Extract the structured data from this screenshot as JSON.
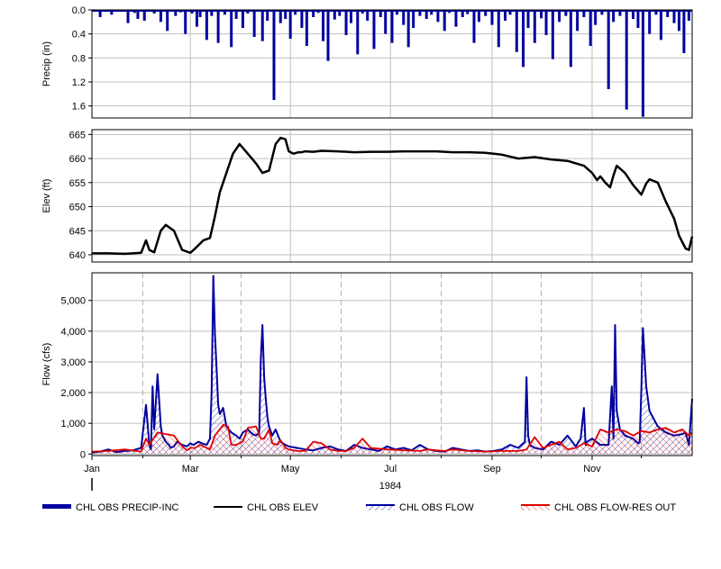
{
  "chart_data": [
    {
      "type": "bar",
      "ylabel": "Precip (in)",
      "yticks": [
        "0.0",
        "0.4",
        "0.8",
        "1.2",
        "1.6"
      ],
      "ylim": [
        0,
        1.8
      ],
      "y_inverted": true,
      "grid": true,
      "series": [
        {
          "legend_key": "CHL OBS PRECIP-INC",
          "color": "#0000a0",
          "x_day": [
            5,
            12,
            22,
            26,
            28,
            32,
            38,
            42,
            46,
            51,
            54,
            57,
            61,
            64,
            66,
            70,
            73,
            77,
            81,
            85,
            88,
            92,
            95,
            99,
            104,
            107,
            111,
            115,
            118,
            121,
            124,
            128,
            131,
            135,
            138,
            141,
            144,
            148,
            151,
            155,
            158,
            162,
            165,
            168,
            172,
            176,
            179,
            183,
            186,
            190,
            193,
            196,
            200,
            204,
            207,
            211,
            215,
            218,
            222,
            226,
            229,
            233,
            236,
            240,
            244,
            248,
            252,
            255,
            259,
            263,
            266,
            270,
            274,
            277,
            281,
            285,
            289,
            292,
            296,
            300,
            304,
            307,
            311,
            315,
            318,
            322,
            326,
            330,
            333,
            336,
            340,
            344,
            347,
            351,
            355,
            358,
            361,
            364
          ],
          "values": [
            0.12,
            0.08,
            0.22,
            0.05,
            0.15,
            0.18,
            0.06,
            0.2,
            0.35,
            0.1,
            0.04,
            0.4,
            0.06,
            0.28,
            0.12,
            0.5,
            0.1,
            0.55,
            0.08,
            0.62,
            0.15,
            0.3,
            0.06,
            0.45,
            0.52,
            0.18,
            1.5,
            0.22,
            0.15,
            0.48,
            0.08,
            0.3,
            0.6,
            0.12,
            0.05,
            0.52,
            0.85,
            0.16,
            0.1,
            0.42,
            0.22,
            0.74,
            0.06,
            0.18,
            0.65,
            0.12,
            0.4,
            0.55,
            0.08,
            0.25,
            0.62,
            0.3,
            0.1,
            0.15,
            0.08,
            0.2,
            0.35,
            0.05,
            0.28,
            0.12,
            0.07,
            0.55,
            0.2,
            0.1,
            0.25,
            0.62,
            0.18,
            0.08,
            0.7,
            0.95,
            0.3,
            0.55,
            0.14,
            0.42,
            0.82,
            0.2,
            0.1,
            0.95,
            0.35,
            0.12,
            0.6,
            0.25,
            0.08,
            1.32,
            0.2,
            0.1,
            1.66,
            0.15,
            0.3,
            1.78,
            0.4,
            0.08,
            0.5,
            0.12,
            0.22,
            0.35,
            0.72,
            0.18
          ]
        }
      ]
    },
    {
      "type": "line",
      "ylabel": "Elev (ft)",
      "yticks": [
        "640",
        "645",
        "650",
        "655",
        "660",
        "665"
      ],
      "ylim": [
        638.5,
        666
      ],
      "grid": true,
      "series": [
        {
          "legend_key": "CHL OBS ELEV",
          "color": "#000000",
          "x_day": [
            0,
            10,
            20,
            25,
            30,
            33,
            35,
            38,
            42,
            45,
            50,
            55,
            60,
            62,
            65,
            68,
            72,
            75,
            78,
            80,
            83,
            86,
            90,
            95,
            100,
            104,
            108,
            112,
            115,
            118,
            120,
            123,
            126,
            128,
            130,
            135,
            140,
            150,
            160,
            170,
            180,
            190,
            200,
            210,
            220,
            230,
            240,
            250,
            260,
            270,
            280,
            290,
            300,
            305,
            308,
            310,
            313,
            316,
            318,
            320,
            325,
            330,
            335,
            338,
            340,
            345,
            350,
            355,
            358,
            362,
            364,
            366
          ],
          "values": [
            640.3,
            640.3,
            640.2,
            640.3,
            640.4,
            643,
            641,
            640.5,
            645,
            646.2,
            645,
            641,
            640.4,
            641,
            642,
            643,
            643.5,
            648,
            653,
            655,
            658,
            661,
            663,
            661,
            659,
            657,
            657.5,
            663,
            664.3,
            664,
            661.5,
            661,
            661.3,
            661.3,
            661.5,
            661.4,
            661.6,
            661.5,
            661.3,
            661.4,
            661.4,
            661.5,
            661.5,
            661.5,
            661.3,
            661.3,
            661.2,
            660.8,
            660,
            660.3,
            659.8,
            659.5,
            658.5,
            657,
            655.5,
            656.3,
            655,
            654,
            656.5,
            658.5,
            657,
            654.5,
            652.5,
            654.8,
            655.7,
            655,
            651,
            647.5,
            644,
            641.3,
            641,
            643.8
          ]
        }
      ]
    },
    {
      "type": "area",
      "ylabel": "Flow (cfs)",
      "yticks": [
        "0",
        "1,000",
        "2,000",
        "3,000",
        "4,000",
        "5,000"
      ],
      "ylim": [
        -50,
        5900
      ],
      "grid": true,
      "xticks": [
        "Jan",
        "Mar",
        "May",
        "Jul",
        "Sep",
        "Nov"
      ],
      "xtick_days": [
        0,
        60,
        121,
        182,
        244,
        305
      ],
      "year_label": "1984",
      "series": [
        {
          "legend_key": "CHL OBS FLOW",
          "color": "#0000a0",
          "x_day": [
            0,
            5,
            10,
            15,
            20,
            25,
            30,
            33,
            35,
            36,
            37,
            38,
            40,
            42,
            43,
            44,
            45,
            46,
            47,
            48,
            50,
            52,
            55,
            58,
            60,
            62,
            65,
            67,
            70,
            72,
            73,
            74,
            75,
            76,
            77,
            78,
            80,
            82,
            85,
            88,
            90,
            92,
            95,
            98,
            100,
            102,
            103,
            104,
            105,
            106,
            107,
            108,
            110,
            112,
            115,
            118,
            120,
            125,
            130,
            135,
            140,
            145,
            150,
            155,
            160,
            165,
            170,
            175,
            180,
            185,
            190,
            195,
            200,
            205,
            210,
            215,
            220,
            225,
            230,
            235,
            240,
            245,
            250,
            255,
            260,
            264,
            265,
            266,
            267,
            270,
            275,
            280,
            285,
            290,
            295,
            298,
            300,
            301,
            302,
            305,
            310,
            315,
            316,
            317,
            318,
            319,
            320,
            322,
            325,
            330,
            332,
            333,
            334,
            335,
            336,
            338,
            340,
            345,
            350,
            355,
            360,
            362,
            363,
            364,
            366
          ],
          "values": [
            50,
            80,
            150,
            60,
            100,
            120,
            200,
            1600,
            300,
            150,
            2200,
            800,
            2600,
            900,
            600,
            500,
            400,
            350,
            300,
            200,
            250,
            400,
            300,
            250,
            350,
            300,
            400,
            350,
            300,
            500,
            2000,
            5800,
            3900,
            2800,
            1600,
            1300,
            1500,
            900,
            700,
            600,
            500,
            700,
            800,
            650,
            600,
            700,
            3100,
            4200,
            2500,
            1800,
            1200,
            900,
            600,
            800,
            400,
            300,
            250,
            200,
            150,
            120,
            200,
            250,
            150,
            100,
            300,
            200,
            150,
            100,
            250,
            150,
            200,
            120,
            300,
            150,
            100,
            80,
            200,
            150,
            100,
            120,
            80,
            100,
            150,
            300,
            200,
            400,
            2500,
            600,
            300,
            200,
            150,
            400,
            300,
            600,
            250,
            500,
            1500,
            300,
            400,
            500,
            300,
            300,
            1250,
            2200,
            500,
            4200,
            1400,
            800,
            600,
            500,
            400,
            350,
            400,
            2100,
            4100,
            2200,
            1400,
            900,
            700,
            600,
            650,
            700,
            500,
            300,
            1800,
            2300,
            1500,
            400
          ]
        },
        {
          "legend_key": "CHL OBS FLOW-RES OUT",
          "color": "#e00000",
          "x_day": [
            0,
            10,
            20,
            30,
            33,
            35,
            40,
            45,
            50,
            55,
            58,
            60,
            63,
            66,
            70,
            72,
            75,
            80,
            83,
            85,
            88,
            92,
            95,
            100,
            103,
            105,
            108,
            110,
            113,
            115,
            118,
            120,
            125,
            130,
            135,
            140,
            145,
            150,
            155,
            160,
            165,
            170,
            180,
            190,
            200,
            205,
            210,
            215,
            220,
            230,
            240,
            250,
            255,
            260,
            265,
            270,
            275,
            280,
            285,
            290,
            295,
            300,
            305,
            310,
            315,
            320,
            325,
            330,
            335,
            340,
            345,
            350,
            355,
            360,
            364,
            366
          ],
          "values": [
            80,
            100,
            150,
            80,
            500,
            300,
            700,
            650,
            600,
            250,
            120,
            200,
            200,
            300,
            200,
            150,
            600,
            950,
            900,
            300,
            300,
            400,
            850,
            900,
            500,
            500,
            800,
            350,
            300,
            450,
            200,
            150,
            100,
            100,
            400,
            350,
            150,
            100,
            100,
            200,
            500,
            200,
            150,
            120,
            100,
            150,
            120,
            100,
            150,
            100,
            80,
            100,
            100,
            100,
            150,
            550,
            200,
            300,
            400,
            150,
            200,
            350,
            250,
            800,
            700,
            800,
            750,
            600,
            750,
            700,
            800,
            850,
            700,
            800,
            600,
            700
          ]
        }
      ]
    }
  ],
  "legend": [
    {
      "label": "CHL OBS PRECIP-INC",
      "style": "thick-line",
      "color": "#0000a0"
    },
    {
      "label": "CHL OBS ELEV",
      "style": "line",
      "color": "#000000"
    },
    {
      "label": "CHL OBS FLOW",
      "style": "hatch-line",
      "color": "#0000a0"
    },
    {
      "label": "CHL OBS FLOW-RES OUT",
      "style": "hatch-line",
      "color": "#e00000"
    }
  ]
}
